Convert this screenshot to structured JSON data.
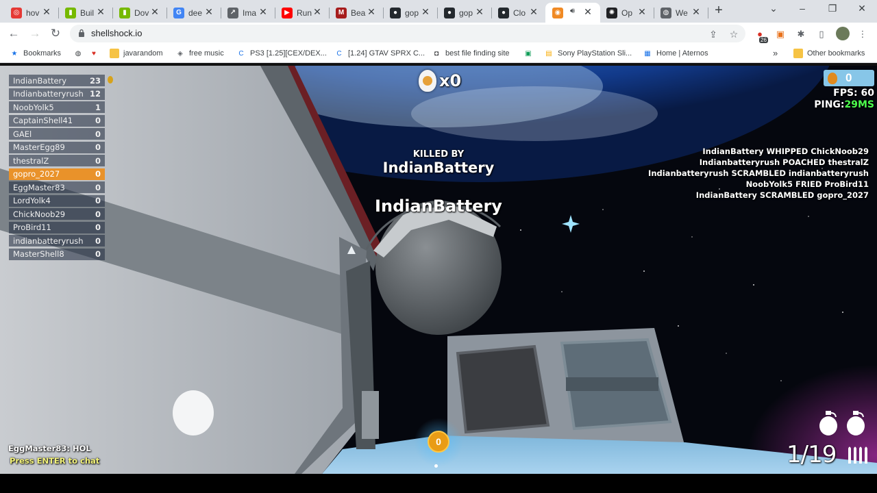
{
  "browser": {
    "tabs": [
      {
        "title": "hov",
        "icon": "recaptcha-icon",
        "color": "#e53935"
      },
      {
        "title": "Buil",
        "icon": "nvidia-icon",
        "color": "#76b900"
      },
      {
        "title": "Dov",
        "icon": "nvidia-icon",
        "color": "#76b900"
      },
      {
        "title": "dee",
        "icon": "google-icon",
        "color": "#4285f4"
      },
      {
        "title": "Ima",
        "icon": "chart-icon",
        "color": "#5f6368"
      },
      {
        "title": "Run",
        "icon": "youtube-icon",
        "color": "#ff0000"
      },
      {
        "title": "Bea",
        "icon": "medium-icon",
        "color": "#a61c1c"
      },
      {
        "title": "gop",
        "icon": "github-icon",
        "color": "#24292e"
      },
      {
        "title": "gop",
        "icon": "github-icon",
        "color": "#24292e"
      },
      {
        "title": "Clo",
        "icon": "github-icon",
        "color": "#24292e"
      },
      {
        "title": "",
        "icon": "shellshock-icon",
        "color": "#f08a24"
      },
      {
        "title": "Op",
        "icon": "openai-icon",
        "color": "#202124"
      },
      {
        "title": "We",
        "icon": "globe-icon",
        "color": "#5f6368"
      }
    ],
    "url": "shellshock.io",
    "ext_badge": "26",
    "bookmarks": [
      {
        "label": "Bookmarks",
        "icon": "star-icon"
      },
      {
        "label": "",
        "icon": "globe-icon"
      },
      {
        "label": "",
        "icon": "heart-icon"
      },
      {
        "label": "javarandom",
        "icon": "folder-icon"
      },
      {
        "label": "free music",
        "icon": "alien-icon"
      },
      {
        "label": "PS3 [1.25][CEX/DEX...",
        "icon": "c-icon"
      },
      {
        "label": "[1.24] GTAV SPRX C...",
        "icon": "c-icon"
      },
      {
        "label": "best file finding site",
        "icon": "robot-icon"
      },
      {
        "label": "",
        "icon": "green-app-icon"
      },
      {
        "label": "Sony PlayStation Sli...",
        "icon": "bag-icon"
      },
      {
        "label": "Home | Aternos",
        "icon": "aternos-icon"
      }
    ],
    "other_bookmarks": "Other bookmarks",
    "overflow": "»"
  },
  "game": {
    "scoreboard": [
      {
        "name": "IndianBattery",
        "score": "23"
      },
      {
        "name": "Indianbatteryrush",
        "score": "12"
      },
      {
        "name": "NoobYolk5",
        "score": "1"
      },
      {
        "name": "CaptainShell41",
        "score": "0"
      },
      {
        "name": "GAEl",
        "score": "0"
      },
      {
        "name": "MasterEgg89",
        "score": "0"
      },
      {
        "name": "thestralZ",
        "score": "0"
      },
      {
        "name": "gopro_2027",
        "score": "0",
        "me": true
      },
      {
        "name": "EggMaster83",
        "score": "0"
      },
      {
        "name": "LordYolk4",
        "score": "0"
      },
      {
        "name": "ChickNoob29",
        "score": "0"
      },
      {
        "name": "ProBird11",
        "score": "0"
      },
      {
        "name": "indianbatteryrush",
        "score": "0"
      },
      {
        "name": "MasterShell8",
        "score": "0"
      }
    ],
    "kills": "x0",
    "killed_by_label": "KILLED BY",
    "killed_by_name": "IndianBattery",
    "nametag": "IndianBattery",
    "eggs": "0",
    "fps_label": "FPS:",
    "fps": "60",
    "ping_label": "PING:",
    "ping": "29MS",
    "killfeed": [
      "IndianBattery WHIPPED ChickNoob29",
      "Indianbatteryrush POACHED thestralZ",
      "Indianbatteryrush SCRAMBLED indianbatteryrush",
      "NoobYolk5 FRIED ProBird11",
      "IndianBattery SCRAMBLED gopro_2027"
    ],
    "chat_line": "EggMaster83: HOL",
    "chat_hint": "Press ENTER to chat",
    "ammo": "1/19",
    "center_coin": "0"
  }
}
